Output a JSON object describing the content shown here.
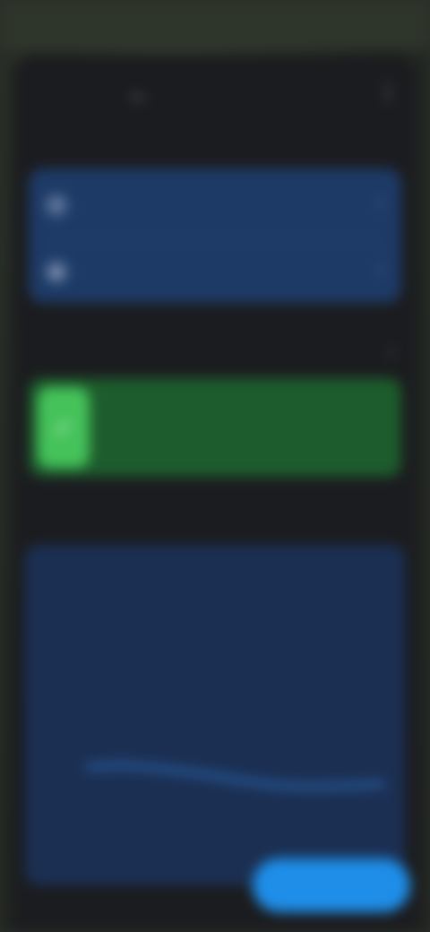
{
  "status_bar": {
    "time": "",
    "icons": ""
  },
  "header": {
    "title": "",
    "back_glyph": "←",
    "menu_glyph": "⋮"
  },
  "login": {
    "section_label": "",
    "items": [
      {
        "icon": "key-icon",
        "glyph": "✦",
        "label": ""
      },
      {
        "icon": "shield-icon",
        "glyph": "◆",
        "label": ""
      }
    ],
    "chevron_glyph": "›"
  },
  "alert": {
    "section_label": "",
    "action_glyph": "›",
    "icon_glyph": "✓",
    "title": "",
    "subtitle": ""
  },
  "stats": {
    "section_label": "",
    "items": [
      {
        "value": "",
        "label": ""
      },
      {
        "value": "",
        "label": ""
      },
      {
        "value": "",
        "label": ""
      }
    ],
    "chart_title": "",
    "chart_range": ""
  },
  "footer": {
    "icon": "user-icon",
    "icon_glyph": "●",
    "text": "",
    "primary_button": ""
  },
  "colors": {
    "login_card": "#1d3a66",
    "alert_card": "#1d5c2c",
    "alert_icon": "#45c25a",
    "stats_card": "#1b2f52",
    "chart_line": "#2f7fd6",
    "primary_button": "#1e8ee9"
  },
  "chart_data": {
    "type": "line",
    "x": [
      1,
      2,
      3,
      4,
      5,
      6,
      7,
      8,
      9
    ],
    "series": [
      {
        "values": [
          62,
          64,
          60,
          55,
          48,
          42,
          40,
          41,
          43
        ]
      }
    ],
    "ylim": [
      0,
      100
    ],
    "grid": false,
    "x_tick_labels": [
      "",
      "",
      "",
      "",
      ""
    ],
    "y_tick_labels": [
      "",
      ""
    ]
  }
}
